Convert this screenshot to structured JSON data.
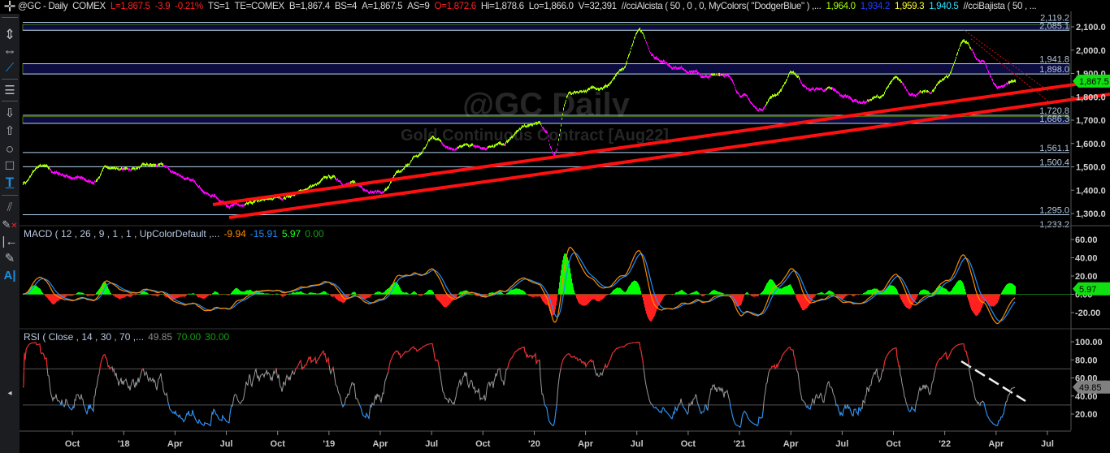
{
  "header": {
    "symbol": "@GC - Daily  COMEX",
    "last": "L=1,867.5",
    "change": "-3.9",
    "change_pct": "-0.21%",
    "ts": "TS=1",
    "te": "TE=COMEX",
    "bid": "B=1,867.4",
    "bid_size": "BS=4",
    "ask": "A=1,867.5",
    "ask_size": "AS=9",
    "open": "O=1,872.6",
    "high": "Hi=1,878.6",
    "low": "Lo=1,866.0",
    "volume": "V=32,391",
    "study1": "//cciAlcista ( 50 , 0 , 0, MyColors( \"DodgerBlue\" ) ,...",
    "study1_values": [
      "1,964.0",
      "1,934.2",
      "1,959.3",
      "1,940.5"
    ],
    "study2": "//cciBajista ( 50 , ..."
  },
  "watermark": {
    "title": "@GC Daily",
    "subtitle": "Gold Continuous Contract [Aug22]"
  },
  "toolbar": [
    "crosshair-icon",
    "move-vertical-icon",
    "move-horizontal-icon",
    "trendline-icon",
    "horizontal-lines-icon",
    "arrow-down-icon",
    "arrow-up-icon",
    "ellipse-icon",
    "rectangle-icon",
    "text-icon",
    "parallel-lines-icon",
    "remove-drawings-icon",
    "snap-left-icon",
    "drawing-pen-icon",
    "text-label-icon"
  ],
  "colors": {
    "up": "#a6ff00",
    "down": "#ff00ff",
    "trend": "#ff1010",
    "level": "#b4d2f0",
    "zone": "#0c0c40",
    "macd": "#ff8c00",
    "signal": "#1e90ff",
    "hist_up": "#00ff00",
    "hist_down": "#ff2020",
    "rsi": "#9a9a9a"
  },
  "chart_data": [
    {
      "type": "line",
      "title": "@GC Daily - Gold Continuous Contract [Aug22]",
      "xlabel": "",
      "ylabel": "Price",
      "ylim": [
        1233,
        2150
      ],
      "x_tick_labels": [
        "Oct",
        "'18",
        "Apr",
        "Jul",
        "Oct",
        "'19",
        "Apr",
        "Jul",
        "Oct",
        "'20",
        "Apr",
        "Jul",
        "Oct",
        "'21",
        "Apr",
        "Jul",
        "Oct",
        "'22",
        "Apr",
        "Jul"
      ],
      "y_ticks": [
        "2,100.0",
        "2,000.0",
        "1,900.0",
        "1,800.0",
        "1,700.0",
        "1,600.0",
        "1,500.0",
        "1,400.0",
        "1,300.0"
      ],
      "months": [
        "2017-08",
        "2017-09",
        "2017-10",
        "2017-11",
        "2017-12",
        "2018-01",
        "2018-02",
        "2018-03",
        "2018-04",
        "2018-05",
        "2018-06",
        "2018-07",
        "2018-08",
        "2018-09",
        "2018-10",
        "2018-11",
        "2018-12",
        "2019-01",
        "2019-02",
        "2019-03",
        "2019-04",
        "2019-05",
        "2019-06",
        "2019-07",
        "2019-08",
        "2019-09",
        "2019-10",
        "2019-11",
        "2019-12",
        "2020-01",
        "2020-02",
        "2020-03",
        "2020-04",
        "2020-05",
        "2020-06",
        "2020-07",
        "2020-08",
        "2020-09",
        "2020-10",
        "2020-11",
        "2020-12",
        "2021-01",
        "2021-02",
        "2021-03",
        "2021-04",
        "2021-05",
        "2021-06",
        "2021-07",
        "2021-08",
        "2021-09",
        "2021-10",
        "2021-11",
        "2021-12",
        "2022-01",
        "2022-02",
        "2022-03",
        "2022-04",
        "2022-05",
        "2022-06"
      ],
      "closes": [
        1432,
        1500,
        1467,
        1456,
        1432,
        1500,
        1490,
        1500,
        1500,
        1467,
        1432,
        1380,
        1345,
        1328,
        1345,
        1363,
        1387,
        1420,
        1450,
        1432,
        1408,
        1397,
        1467,
        1537,
        1623,
        1590,
        1590,
        1572,
        1590,
        1659,
        1693,
        1623,
        1815,
        1832,
        1850,
        1902,
        2075,
        1971,
        1937,
        1920,
        1884,
        1902,
        1815,
        1745,
        1815,
        1902,
        1832,
        1832,
        1797,
        1780,
        1797,
        1867,
        1815,
        1815,
        1884,
        2041,
        1954,
        1832,
        1867.5
      ],
      "last_price": "1,867.5",
      "levels": [
        "2,119.2",
        "2,085.1",
        "1,941.8",
        "1,898.0",
        "1,720.8",
        "1,686.3",
        "1,561.1",
        "1,500.4",
        "1,295.0",
        "1,233.2"
      ],
      "level_values": [
        2119.2,
        2085.1,
        1941.8,
        1898.0,
        1720.8,
        1686.3,
        1561.1,
        1500.4,
        1295.0,
        1233.2
      ],
      "zones": [
        [
          2085.1,
          2110
        ],
        [
          1898.0,
          1941.8
        ],
        [
          1686.3,
          1715
        ]
      ]
    },
    {
      "type": "line",
      "title": "MACD ( 12 , 26 , 9 , 1 , 1 , UpColorDefault ,...",
      "series_values": {
        "macd": "-9.94",
        "avg": "-15.91",
        "diff": "5.97",
        "zero": "0.00"
      },
      "y_ticks": [
        "60.00",
        "40.00",
        "20.00",
        "0.00",
        "-20.00"
      ],
      "ylim": [
        -30,
        65
      ],
      "last_tag": "5.97"
    },
    {
      "type": "line",
      "title": "RSI ( Close , 14 , 30 , 70 ,...",
      "series_values": {
        "rsi": "49.85",
        "overbought": "70.00",
        "oversold": "30.00"
      },
      "y_ticks": [
        "100.00",
        "80.00",
        "60.00",
        "40.00",
        "20.00"
      ],
      "ylim": [
        10,
        110
      ],
      "last_tag": "49.85"
    }
  ]
}
